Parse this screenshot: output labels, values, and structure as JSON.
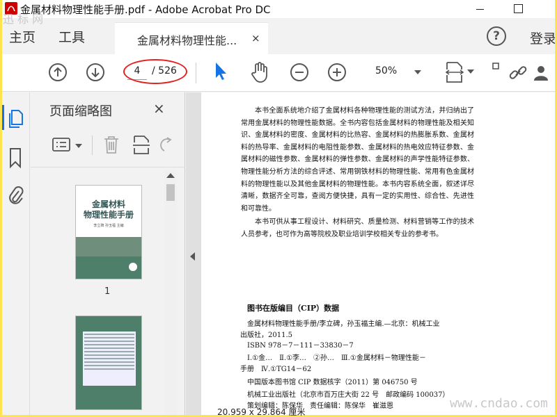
{
  "window": {
    "title": "金属材料物理性能手册.pdf - Adobe Acrobat Pro DC"
  },
  "tabs": {
    "home": "主页",
    "tools": "工具",
    "document": "金属材料物理性能...",
    "close": "×",
    "help": "?",
    "login": "登录"
  },
  "toolbar": {
    "current_page": "4",
    "total_pages": "/ 526",
    "zoom": "50%"
  },
  "thumbnails_panel": {
    "title": "页面缩略图",
    "close": "×",
    "thumbnails": [
      {
        "page_label": "1",
        "cover_title_line1": "金属材料",
        "cover_title_line2": "物理性能手册",
        "cover_author": "李立碑 孙玉福 主编"
      }
    ]
  },
  "document": {
    "paragraphs": [
      "本书全面系统地介绍了金属材料各种物理性能的测试方法，并归纳出了常用金属材料的物理性能数据。全书内容包括金属材料的物理性能及相关知识、金属材料的密度、金属材料的比热容、金属材料的热膨胀系数、金属材料的热导率、金属材料的电阻性能参数、金属材料的热电效应特征参数、金属材料的磁性参数、金属材料的弹性参数、金属材料的声学性能特征参数、物理性能分析方法的综合评述、常用钢铁材料的物理性能、常用有色金属材料的物理性能以及其他金属材料的物理性能。本书内容系统全面，叙述详尽清晰，数据齐全可靠，查阅方便快捷，具有一定的实用性、综合性、先进性和可靠性。",
      "本书可供从事工程设计、材料研究、质量检测、材料营销等工作的技术人员参考，也可作为高等院校及职业培训学校相关专业的参考书。"
    ],
    "cip_title": "图书在版编目（CIP）数据",
    "cip_lines": [
      "金属材料物理性能手册/李立碑，孙玉福主编.—北京：机械工业",
      "出版社，2011.5",
      "ISBN 978－7－111－33830－7",
      "Ⅰ.①金…　Ⅱ.①李…　②孙…　Ⅲ.①金属材料－物理性能－",
      "手册　Ⅳ.①TG14－62",
      "中国版本图书馆 CIP 数据核字（2011）第 046750 号",
      "机械工业出版社（北京市百万庄大街 22 号　邮政编码 100037）",
      "策划编辑：陈保华　责任编辑：陈保华　崔滋恩"
    ]
  },
  "status": {
    "page_size": "20.959 x 29.864 厘米"
  },
  "watermarks": {
    "top_left": "迅 标 网",
    "bottom_right": "www.cndao.com"
  },
  "colors": {
    "accent": "#1473e6",
    "highlight_ellipse": "#e32020",
    "cover_green": "#4e7f6a",
    "outer_frame": "#ffe34f"
  }
}
